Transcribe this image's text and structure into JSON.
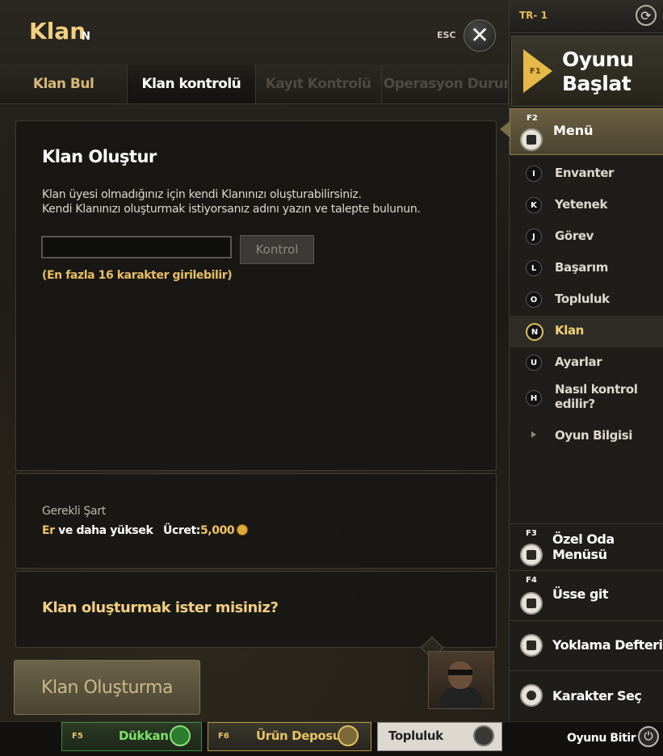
{
  "header": {
    "title": "Klan",
    "title_key": "N",
    "esc_label": "ESC",
    "close_icon": "close-icon"
  },
  "tabs": [
    {
      "label": "Klan Bul",
      "active": false,
      "enabled": true
    },
    {
      "label": "Klan kontrolü",
      "active": true,
      "enabled": true
    },
    {
      "label": "Kayıt Kontrolü",
      "active": false,
      "enabled": false
    },
    {
      "label": "Operasyon Durumu",
      "active": false,
      "enabled": false
    }
  ],
  "create_panel": {
    "heading": "Klan Oluştur",
    "desc_line1": "Klan üyesi olmadığınız için  kendi Klanınızı oluşturabilirsiniz.",
    "desc_line2": "Kendi Klanınızı oluşturmak istiyorsanız  adını yazın ve talepte bulunun.",
    "name_input_value": "",
    "name_input_placeholder": "",
    "check_button": "Kontrol",
    "hint": "(En fazla 16 karakter girilebilir)"
  },
  "requirements": {
    "label": "Gerekli Şart",
    "rank": "Er",
    "rank_suffix": "ve daha yüksek",
    "fee_label": "Ücret:",
    "fee_value": "5,000"
  },
  "confirm": {
    "question": "Klan oluşturmak ister misiniz?"
  },
  "create_button": "Klan Oluşturma",
  "sidebar": {
    "server": "TR- 1",
    "start_key": "F1",
    "start_line1": "Oyunu",
    "start_line2": "Başlat",
    "menu_key": "F2",
    "menu_label": "Menü",
    "items": [
      {
        "key": "I",
        "label": "Envanter",
        "active": false
      },
      {
        "key": "K",
        "label": "Yetenek",
        "active": false
      },
      {
        "key": "J",
        "label": "Görev",
        "active": false
      },
      {
        "key": "L",
        "label": "Başarım",
        "active": false
      },
      {
        "key": "O",
        "label": "Topluluk",
        "active": false
      },
      {
        "key": "N",
        "label": "Klan",
        "active": true
      },
      {
        "key": "U",
        "label": "Ayarlar",
        "active": false
      },
      {
        "key": "H",
        "label": "Nasıl kontrol edilir?",
        "line1": "Nasıl kontrol",
        "line2": "edilir?",
        "active": false
      },
      {
        "key": "",
        "label": "Oyun Bilgisi",
        "active": false
      }
    ],
    "private_room_key": "F3",
    "private_room_line1": "Özel Oda",
    "private_room_line2": "Menüsü",
    "base_key": "F4",
    "base_label": "Üsse git",
    "attendance_label": "Yoklama Defteri",
    "character_label": "Karakter Seç"
  },
  "bottom": {
    "shop_key": "F5",
    "shop_label": "Dükkan",
    "depot_key": "F6",
    "depot_label": "Ürün Deposu",
    "community_label": "Topluluk",
    "quit_label": "Oyunu Bitir"
  },
  "colors": {
    "accent_gold": "#f2cf80",
    "shop_green": "#7ee36a",
    "active_item": "#f3d074"
  }
}
